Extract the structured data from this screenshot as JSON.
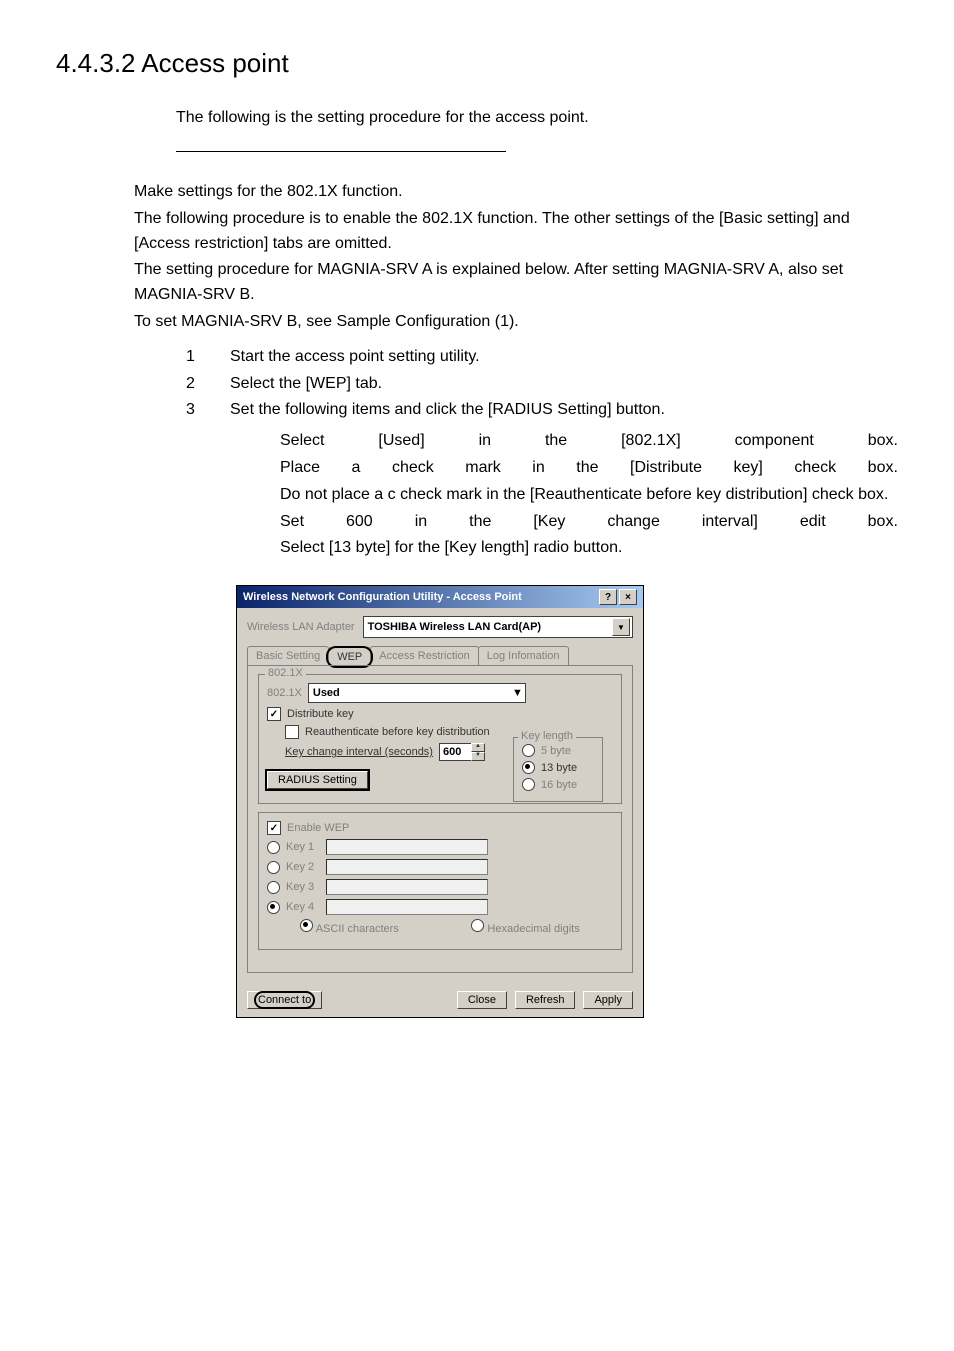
{
  "heading": "4.4.3.2  Access point",
  "intro": "The following is the setting procedure for the access point.",
  "body": {
    "p1": "Make settings for the 802.1X function.",
    "p2": "The following procedure is to enable the 802.1X function.  The other settings of the [Basic setting] and [Access restriction] tabs are omitted.",
    "p3": "The setting procedure for MAGNIA-SRV A is explained below. After setting MAGNIA-SRV A, also set MAGNIA-SRV B.",
    "p4": "To set MAGNIA-SRV B, see Sample Configuration (1)."
  },
  "steps": [
    {
      "n": "1",
      "t": "Start the access point setting utility."
    },
    {
      "n": "2",
      "t": "Select the [WEP] tab."
    },
    {
      "n": "3",
      "t": "Set the following items and click the [RADIUS Setting] button."
    }
  ],
  "sub": {
    "l1": [
      "Select",
      "[Used]",
      "in",
      "the",
      "[802.1X]",
      "component",
      "box."
    ],
    "l2": [
      "Place",
      "a",
      "check",
      "mark",
      "in",
      "the",
      "[Distribute",
      "key]",
      "check",
      "box."
    ],
    "l3": "Do not place a c check mark in the [Reauthenticate before key distribution] check box.",
    "l4": [
      "Set",
      "600",
      "in",
      "the",
      "[Key",
      "change",
      "interval]",
      "edit",
      "box."
    ],
    "l5": "Select [13 byte] for the [Key length] radio button."
  },
  "dlg": {
    "title": "Wireless Network Configuration Utility - Access Point",
    "help": "?",
    "close_x": "×",
    "adapter_label": "Wireless LAN Adapter",
    "adapter_value": "TOSHIBA Wireless LAN Card(AP)",
    "tabs": [
      "Basic Setting",
      "WEP",
      "Access Restriction",
      "Log Infomation"
    ],
    "fs_8021x": "802.1X",
    "combo_8021x": "802.1X",
    "combo_8021x_val": "Used",
    "distribute": "Distribute key",
    "reauth": "Reauthenticate before key distribution",
    "interval_label": "Key change interval (seconds)",
    "interval_val": "600",
    "keylen": "Key length",
    "kl5": "5 byte",
    "kl13": "13 byte",
    "kl16": "16 byte",
    "radius_btn": "RADIUS Setting",
    "enable_wep": "Enable WEP",
    "k1": "Key 1",
    "k2": "Key 2",
    "k3": "Key 3",
    "k4": "Key 4",
    "ascii": "ASCII characters",
    "hex": "Hexadecimal digits",
    "connect": "Connect to",
    "close": "Close",
    "refresh": "Refresh",
    "apply": "Apply"
  }
}
